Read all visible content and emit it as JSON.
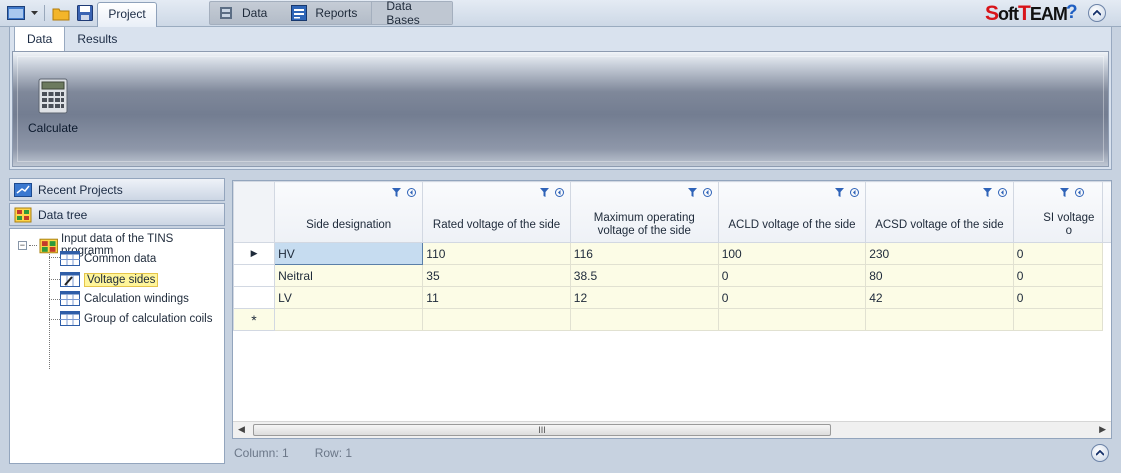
{
  "top": {
    "project_tab": "Project",
    "menu": [
      {
        "label": "Data",
        "icon": "data-icon"
      },
      {
        "label": "Reports",
        "icon": "reports-icon"
      },
      {
        "label": "Data Bases",
        "icon": ""
      }
    ],
    "logo": "SoftTEAM",
    "help": "?"
  },
  "ribbon": {
    "tabs": [
      "Data",
      "Results"
    ],
    "calculate_label": "Calculate"
  },
  "left": {
    "recent_projects": "Recent Projects",
    "data_tree": "Data tree",
    "tree": {
      "root": "Input data of the TINS programm",
      "items": [
        "Common data",
        "Voltage sides",
        "Calculation windings",
        "Group of calculation coils"
      ],
      "selected": "Voltage sides"
    }
  },
  "grid": {
    "columns": [
      "Side designation",
      "Rated voltage of the side",
      "Maximum operating voltage of the side",
      "ACLD voltage of the side",
      "ACSD voltage of the side",
      "SI voltage o"
    ],
    "rows": [
      [
        "HV",
        "110",
        "116",
        "100",
        "230",
        "0"
      ],
      [
        "Neitral",
        "35",
        "38.5",
        "0",
        "80",
        "0"
      ],
      [
        "LV",
        "11",
        "12",
        "0",
        "42",
        "0"
      ]
    ],
    "new_row_marker": "*",
    "current_row_marker": "▶",
    "scroll_thumb": "III"
  },
  "status": {
    "column": "Column: 1",
    "row": "Row: 1"
  },
  "colors": {
    "accent": "#1f5fc2",
    "logo_red": "#d8141a",
    "cell_bg": "#fcfce6",
    "selected_cell": "#c6dcf0"
  }
}
